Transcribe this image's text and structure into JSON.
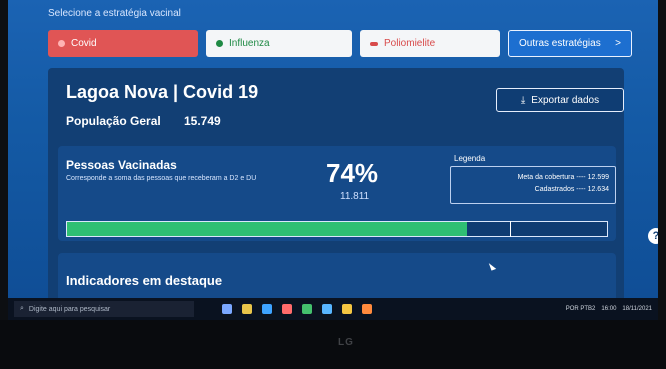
{
  "top": {
    "strategy_label": "Selecione a estratégia vacinal"
  },
  "tabs": [
    {
      "label": "Covid",
      "color": "#e05555"
    },
    {
      "label": "Influenza",
      "color": "#1f8a45"
    },
    {
      "label": "Poliomielite",
      "color": "#d84b4b"
    },
    {
      "label": "Outras estratégias",
      "suffix": ">"
    }
  ],
  "header": {
    "title": "Lagoa Nova | Covid 19",
    "population_label": "População Geral",
    "population_value": "15.749",
    "export_label": "Exportar dados"
  },
  "vaccinated": {
    "title": "Pessoas Vacinadas",
    "description": "Corresponde a soma das pessoas que receberam a D2 e DU",
    "percent": "74%",
    "count": "11.811",
    "progress": 0.74,
    "goal_marker": 0.82,
    "legend_title": "Legenda",
    "legend_meta": "Meta da cobertura ---- 12.599",
    "legend_cadastrados": "Cadastrados ---- 12.634"
  },
  "indicators": {
    "title": "Indicadores em destaque"
  },
  "taskbar": {
    "search_placeholder": "Digite aqui para pesquisar",
    "time": "16:00",
    "date": "18/11/2021",
    "lang": "POR PTB2"
  },
  "monitor": {
    "brand": "LG"
  },
  "help": {
    "label": "?"
  }
}
